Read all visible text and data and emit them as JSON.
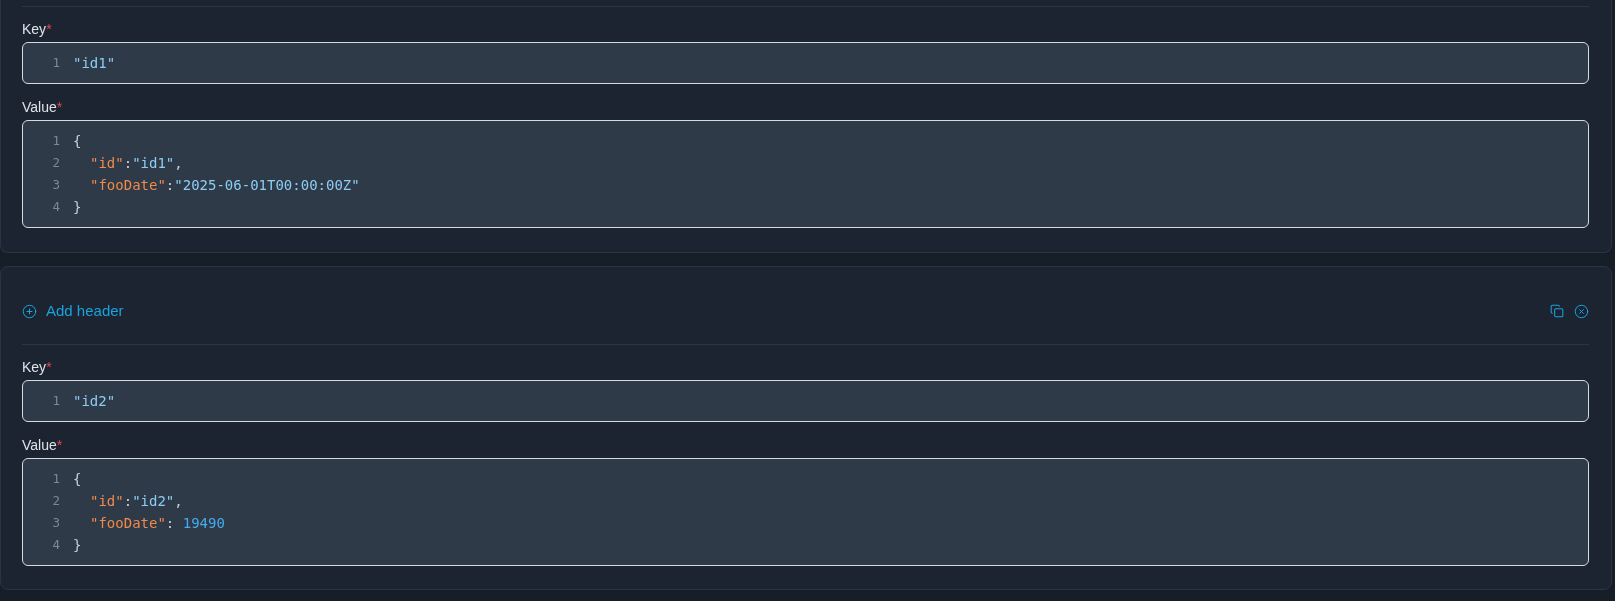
{
  "cards": [
    {
      "fields": [
        {
          "label": "Key",
          "required_mark": "*",
          "lines": [
            {
              "number": "1",
              "tokens": [
                {
                  "kind": "string",
                  "text": "\"id1\""
                }
              ]
            }
          ]
        },
        {
          "label": "Value",
          "required_mark": "*",
          "lines": [
            {
              "number": "1",
              "tokens": [
                {
                  "kind": "punct",
                  "text": "{"
                }
              ],
              "children": [
                {
                  "number": "2",
                  "tokens": [
                    {
                      "kind": "key",
                      "text": "\"id\""
                    },
                    {
                      "kind": "punct",
                      "text": ":"
                    },
                    {
                      "kind": "string",
                      "text": "\"id1\""
                    },
                    {
                      "kind": "punct",
                      "text": ","
                    }
                  ]
                },
                {
                  "number": "3",
                  "tokens": [
                    {
                      "kind": "key",
                      "text": "\"fooDate\""
                    },
                    {
                      "kind": "punct",
                      "text": ":"
                    },
                    {
                      "kind": "string",
                      "text": "\"2025-06-01T00:00:00Z\""
                    }
                  ]
                }
              ]
            },
            {
              "number": "4",
              "tokens": [
                {
                  "kind": "punct",
                  "text": "}"
                }
              ]
            }
          ]
        }
      ]
    },
    {
      "actions": {
        "add_label": "Add header"
      },
      "fields": [
        {
          "label": "Key",
          "required_mark": "*",
          "lines": [
            {
              "number": "1",
              "tokens": [
                {
                  "kind": "string",
                  "text": "\"id2\""
                }
              ]
            }
          ]
        },
        {
          "label": "Value",
          "required_mark": "*",
          "lines": [
            {
              "number": "1",
              "tokens": [
                {
                  "kind": "punct",
                  "text": "{"
                }
              ],
              "children": [
                {
                  "number": "2",
                  "tokens": [
                    {
                      "kind": "key",
                      "text": "\"id\""
                    },
                    {
                      "kind": "punct",
                      "text": ":"
                    },
                    {
                      "kind": "string",
                      "text": "\"id2\""
                    },
                    {
                      "kind": "punct",
                      "text": ","
                    }
                  ]
                },
                {
                  "number": "3",
                  "tokens": [
                    {
                      "kind": "key",
                      "text": "\"fooDate\""
                    },
                    {
                      "kind": "punct",
                      "text": ": "
                    },
                    {
                      "kind": "number",
                      "text": "19490"
                    }
                  ]
                }
              ]
            },
            {
              "number": "4",
              "tokens": [
                {
                  "kind": "punct",
                  "text": "}"
                }
              ]
            }
          ]
        }
      ]
    }
  ]
}
